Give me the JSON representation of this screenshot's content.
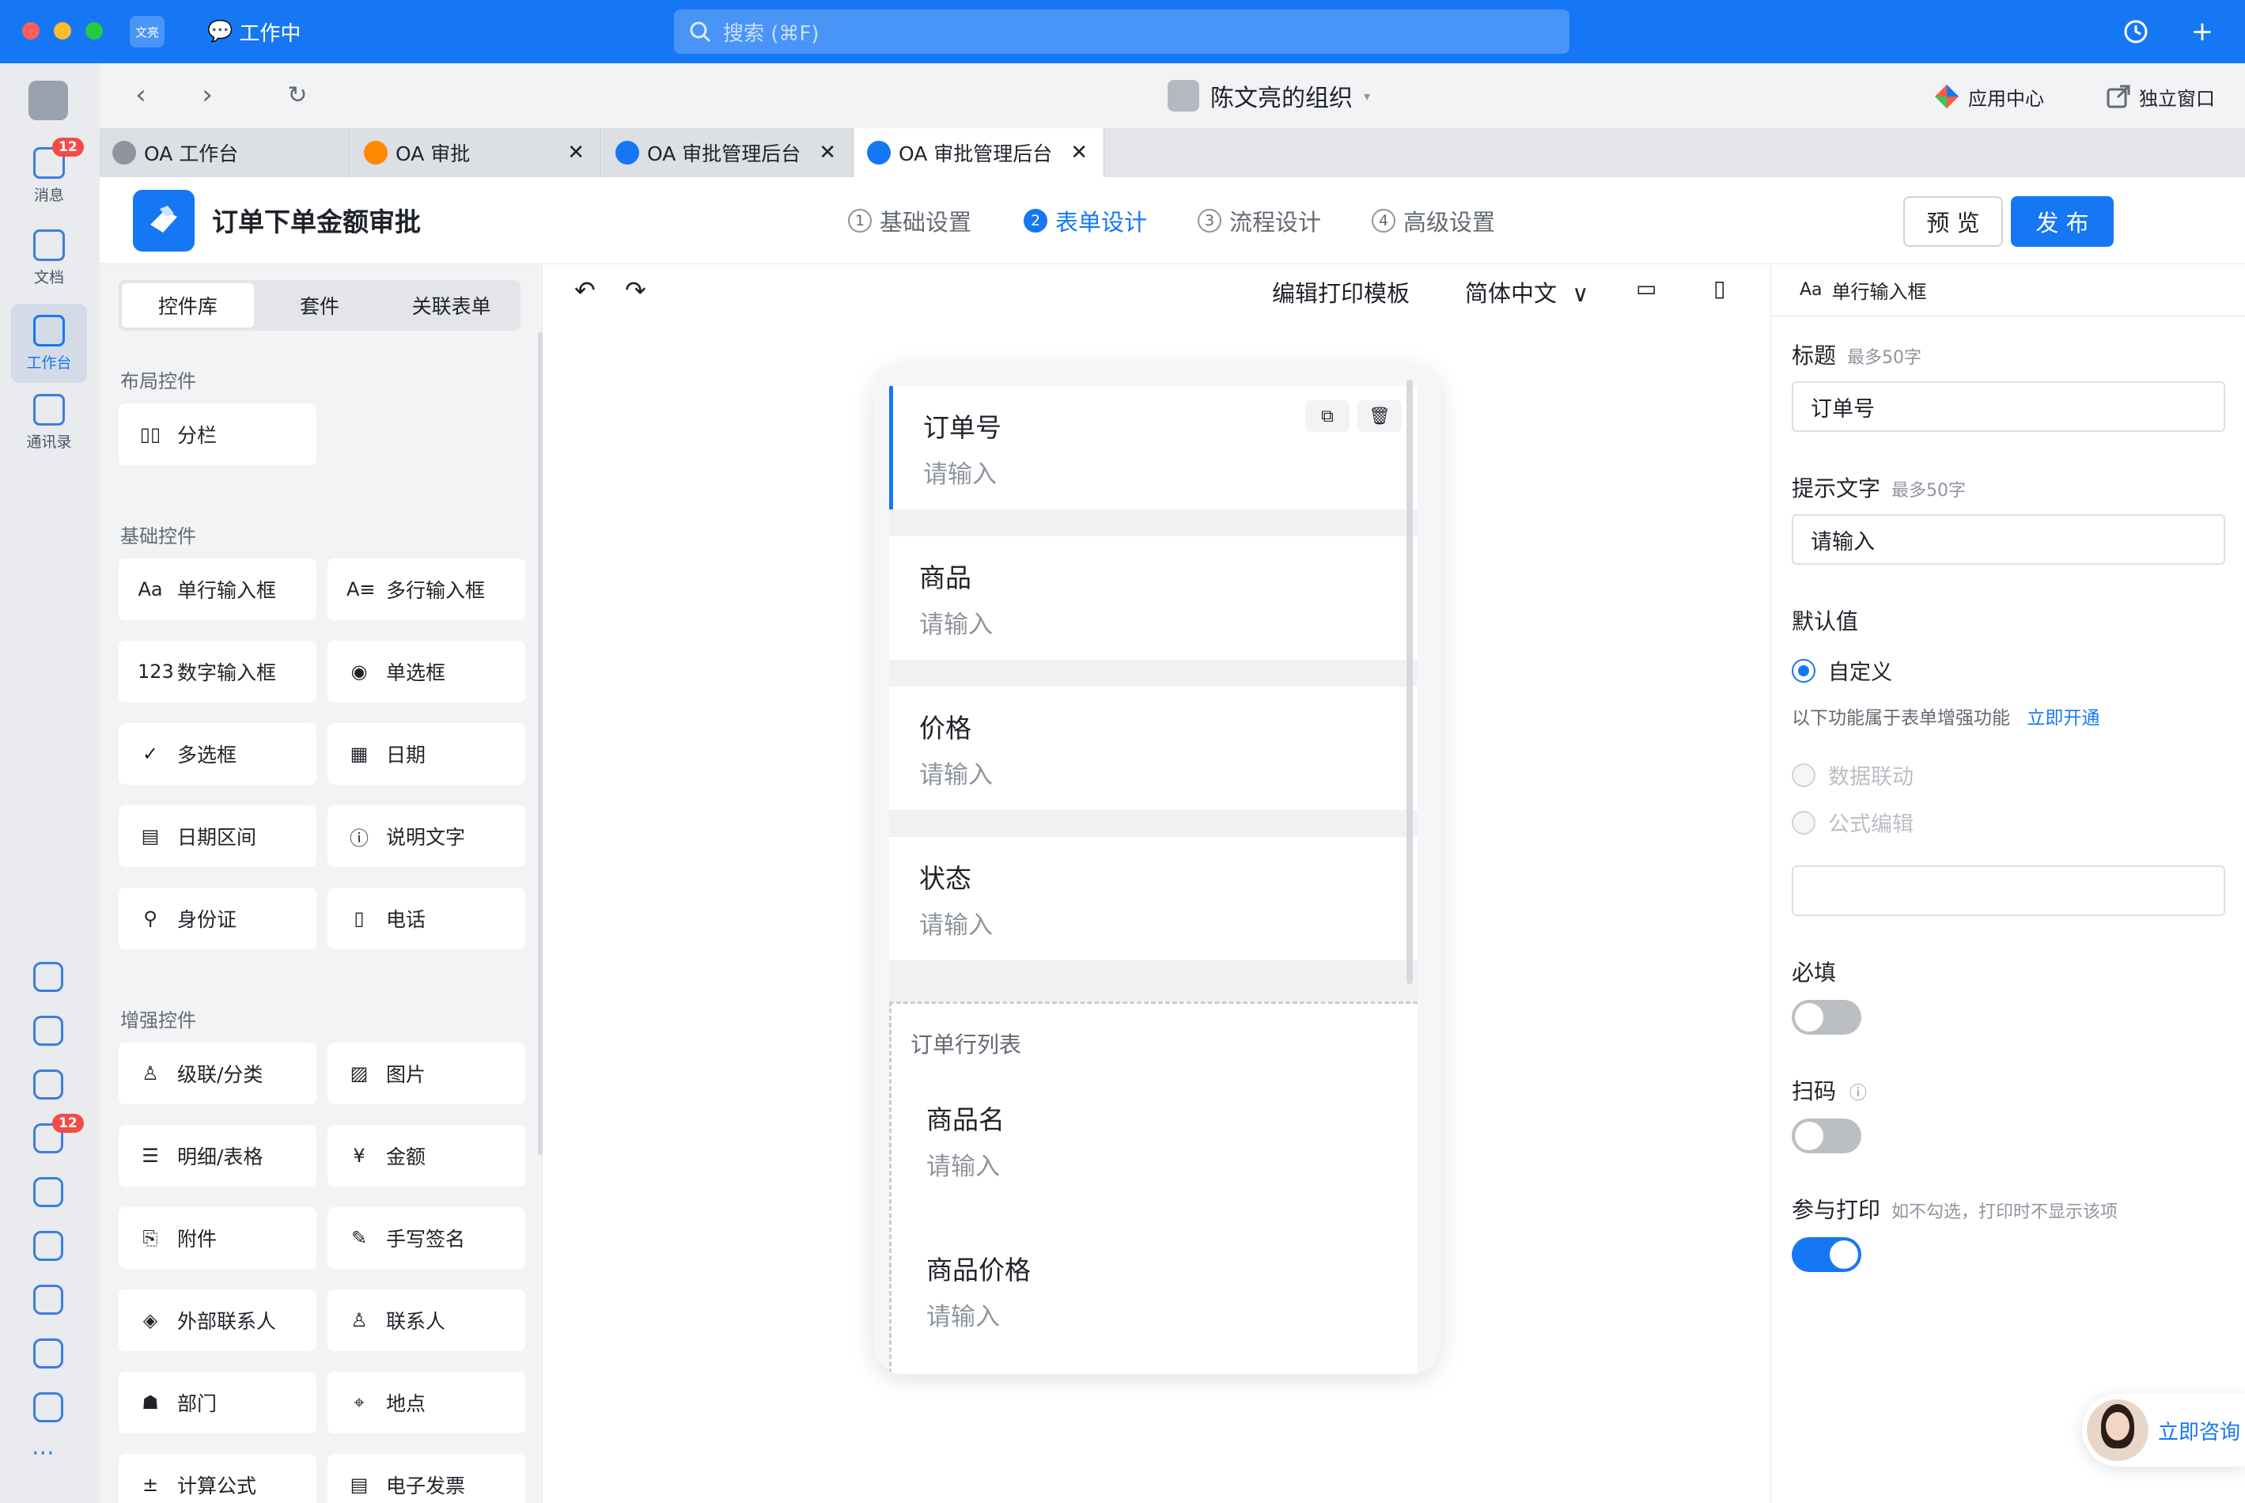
{
  "titlebar": {
    "app_badge": "文亮",
    "status": "工作中",
    "search_placeholder": "搜索 (⌘F)",
    "history_icon": "history-icon",
    "add_icon": "plus-icon"
  },
  "rail": {
    "items": [
      {
        "label": "消息",
        "badge": "12",
        "icon": "message-icon"
      },
      {
        "label": "文档",
        "icon": "doc-icon"
      },
      {
        "label": "工作台",
        "icon": "workbench-icon"
      },
      {
        "label": "通讯录",
        "icon": "contacts-icon"
      }
    ],
    "lower_badge": "12",
    "more": "···"
  },
  "navbar": {
    "org_title": "陈文亮的组织",
    "app_center": "应用中心",
    "standalone": "独立窗口"
  },
  "tabs": [
    {
      "label": "OA 工作台",
      "icon_color": "#8f959e"
    },
    {
      "label": "OA 审批",
      "icon_color": "#ff8800"
    },
    {
      "label": "OA 审批管理后台",
      "icon_color": "#1677f5"
    },
    {
      "label": "OA 审批管理后台",
      "icon_color": "#1677f5"
    }
  ],
  "header": {
    "title": "订单下单金额审批",
    "steps": [
      {
        "num": "1",
        "label": "基础设置"
      },
      {
        "num": "2",
        "label": "表单设计"
      },
      {
        "num": "3",
        "label": "流程设计"
      },
      {
        "num": "4",
        "label": "高级设置"
      }
    ],
    "active_step": 2,
    "preview": "预 览",
    "publish": "发 布"
  },
  "left": {
    "segments": [
      "控件库",
      "套件",
      "关联表单"
    ],
    "layout_title": "布局控件",
    "layout_controls": [
      {
        "label": "分栏",
        "icon": "columns-icon",
        "glyph": "▯▯"
      }
    ],
    "basic_title": "基础控件",
    "basic_controls": [
      {
        "label": "单行输入框",
        "icon": "text-input-icon",
        "glyph": "Aa"
      },
      {
        "label": "多行输入框",
        "icon": "textarea-icon",
        "glyph": "A≡"
      },
      {
        "label": "数字输入框",
        "icon": "number-icon",
        "glyph": "123"
      },
      {
        "label": "单选框",
        "icon": "radio-icon",
        "glyph": "◉"
      },
      {
        "label": "多选框",
        "icon": "checkbox-icon",
        "glyph": "✓"
      },
      {
        "label": "日期",
        "icon": "calendar-icon",
        "glyph": "▦"
      },
      {
        "label": "日期区间",
        "icon": "date-range-icon",
        "glyph": "▤"
      },
      {
        "label": "说明文字",
        "icon": "info-icon",
        "glyph": "ⓘ"
      },
      {
        "label": "身份证",
        "icon": "id-card-icon",
        "glyph": "⚲"
      },
      {
        "label": "电话",
        "icon": "phone-icon",
        "glyph": "▯"
      }
    ],
    "enhanced_title": "增强控件",
    "enhanced_controls": [
      {
        "label": "级联/分类",
        "icon": "cascade-icon",
        "glyph": "♙"
      },
      {
        "label": "图片",
        "icon": "image-icon",
        "glyph": "▨"
      },
      {
        "label": "明细/表格",
        "icon": "table-icon",
        "glyph": "☰"
      },
      {
        "label": "金额",
        "icon": "money-icon",
        "glyph": "¥"
      },
      {
        "label": "附件",
        "icon": "attachment-icon",
        "glyph": "⎘"
      },
      {
        "label": "手写签名",
        "icon": "signature-icon",
        "glyph": "✎"
      },
      {
        "label": "外部联系人",
        "icon": "handshake-icon",
        "glyph": "◈"
      },
      {
        "label": "联系人",
        "icon": "person-icon",
        "glyph": "♙"
      },
      {
        "label": "部门",
        "icon": "org-icon",
        "glyph": "☗"
      },
      {
        "label": "地点",
        "icon": "location-icon",
        "glyph": "⌖"
      },
      {
        "label": "计算公式",
        "icon": "formula-icon",
        "glyph": "±"
      },
      {
        "label": "电子发票",
        "icon": "invoice-icon",
        "glyph": "▤"
      }
    ]
  },
  "canvas": {
    "print_template": "编辑打印模板",
    "language": "简体中文",
    "fields": [
      {
        "label": "订单号",
        "placeholder": "请输入"
      },
      {
        "label": "商品",
        "placeholder": "请输入"
      },
      {
        "label": "价格",
        "placeholder": "请输入"
      },
      {
        "label": "状态",
        "placeholder": "请输入"
      }
    ],
    "subform": {
      "title": "订单行列表",
      "fields": [
        {
          "label": "商品名",
          "placeholder": "请输入"
        },
        {
          "label": "商品价格",
          "placeholder": "请输入"
        }
      ]
    }
  },
  "right": {
    "head": "单行输入框",
    "head_icon": "Aa",
    "title_label": "标题",
    "title_hint": "最多50字",
    "title_value": "订单号",
    "hint_label": "提示文字",
    "hint_hint": "最多50字",
    "hint_value": "请输入",
    "default_label": "默认值",
    "default_custom": "自定义",
    "upgrade_text": "以下功能属于表单增强功能",
    "upgrade_link": "立即开通",
    "linkage": "数据联动",
    "formula": "公式编辑",
    "required_label": "必填",
    "required_on": false,
    "scan_label": "扫码",
    "scan_on": false,
    "print_label": "参与打印",
    "print_hint": "如不勾选，打印时不显示该项",
    "print_on": true,
    "consult": "立即咨询"
  }
}
